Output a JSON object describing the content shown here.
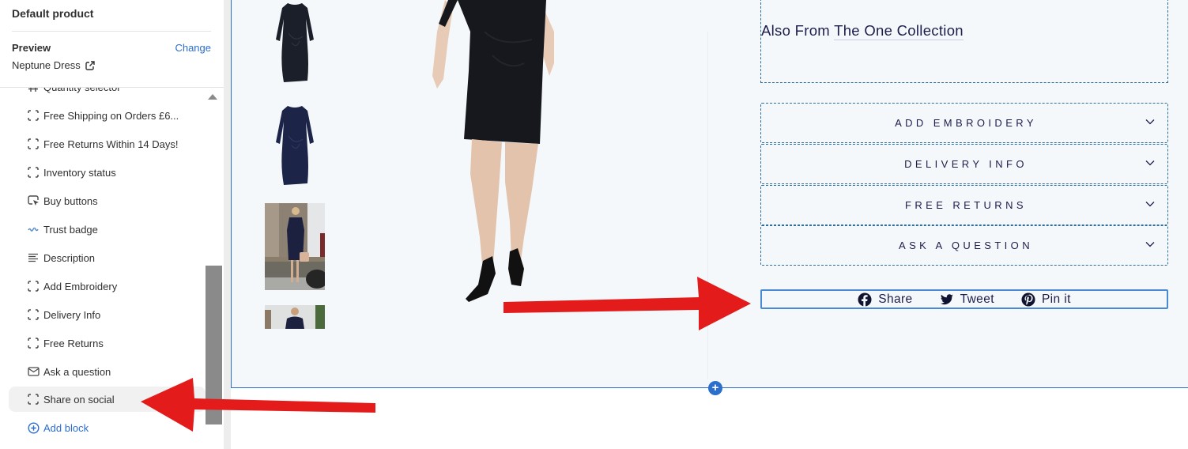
{
  "sidebar": {
    "title": "Default product",
    "preview_label": "Preview",
    "change_label": "Change",
    "product_name": "Neptune Dress",
    "product_link_icon": "external-link-icon",
    "scroll_fraction_visible": 0.42,
    "blocks": [
      {
        "label": "Quantity selector",
        "icon": "hash-icon"
      },
      {
        "label": "Free Shipping on Orders £6...",
        "icon": "dashed-square-icon"
      },
      {
        "label": "Free Returns Within 14 Days!",
        "icon": "dashed-square-icon"
      },
      {
        "label": "Inventory status",
        "icon": "dashed-square-icon"
      },
      {
        "label": "Buy buttons",
        "icon": "cursor-click-icon"
      },
      {
        "label": "Trust badge",
        "icon": "app-logo-icon"
      },
      {
        "label": "Description",
        "icon": "text-lines-icon"
      },
      {
        "label": "Add Embroidery",
        "icon": "dashed-square-icon"
      },
      {
        "label": "Delivery Info",
        "icon": "dashed-square-icon"
      },
      {
        "label": "Free Returns",
        "icon": "dashed-square-icon"
      },
      {
        "label": "Ask a question",
        "icon": "envelope-icon"
      },
      {
        "label": "Share on social",
        "icon": "dashed-square-icon",
        "selected": true
      }
    ],
    "add_block_label": "Add block",
    "add_block_icon": "plus-circle-icon"
  },
  "preview": {
    "thumbnails": [
      {
        "alt": "Dress front view black"
      },
      {
        "alt": "Dress front view navy"
      },
      {
        "alt": "Model wearing dress with handbag"
      },
      {
        "alt": "Model wearing dress indoors"
      }
    ],
    "main_image_alt": "Model wearing Neptune Dress",
    "description": {
      "prefix": "Also From ",
      "link_text": "The One Collection"
    },
    "accordions": [
      {
        "label": "ADD EMBROIDERY"
      },
      {
        "label": "DELIVERY INFO"
      },
      {
        "label": "FREE RETURNS"
      },
      {
        "label": "ASK A QUESTION"
      }
    ],
    "share": [
      {
        "label": "Share",
        "icon": "facebook-icon"
      },
      {
        "label": "Tweet",
        "icon": "twitter-icon"
      },
      {
        "label": "Pin it",
        "icon": "pinterest-icon"
      }
    ],
    "add_section_label": "+"
  },
  "colors": {
    "accent": "#2c6ecb",
    "text_dark": "#1c1d4b",
    "annotation_red": "#e31b1b",
    "canvas_bg": "#f4f8fb"
  }
}
